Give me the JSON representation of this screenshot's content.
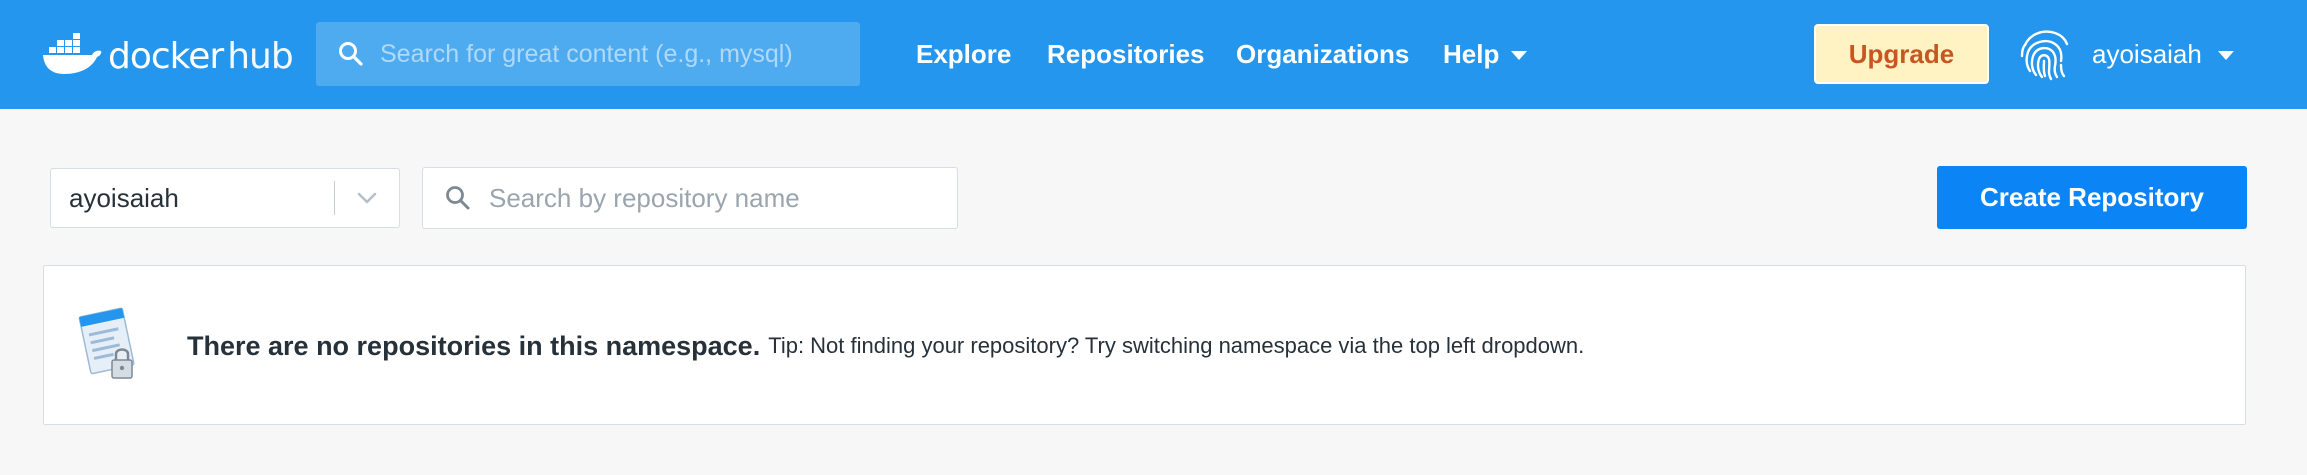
{
  "header": {
    "logo": {
      "brand": "docker",
      "product": "hub"
    },
    "search": {
      "placeholder": "Search for great content (e.g., mysql)"
    },
    "nav": [
      {
        "label": "Explore"
      },
      {
        "label": "Repositories"
      },
      {
        "label": "Organizations"
      },
      {
        "label": "Help"
      }
    ],
    "upgrade_label": "Upgrade",
    "user": {
      "name": "ayoisaiah",
      "avatar_icon": "fingerprint-icon"
    }
  },
  "toolbar": {
    "namespace": {
      "selected": "ayoisaiah"
    },
    "repo_search": {
      "placeholder": "Search by repository name"
    },
    "create_label": "Create Repository"
  },
  "empty_state": {
    "headline": "There are no repositories in this namespace.",
    "tip": "Tip: Not finding your repository? Try switching namespace via the top left dropdown.",
    "illustration_icon": "locked-repository-icon"
  },
  "colors": {
    "topbar": "#2496ed",
    "primary_button": "#0b84f5",
    "upgrade_bg": "#fff3c4",
    "upgrade_text": "#c95621",
    "page_bg": "#f7f7f7"
  }
}
